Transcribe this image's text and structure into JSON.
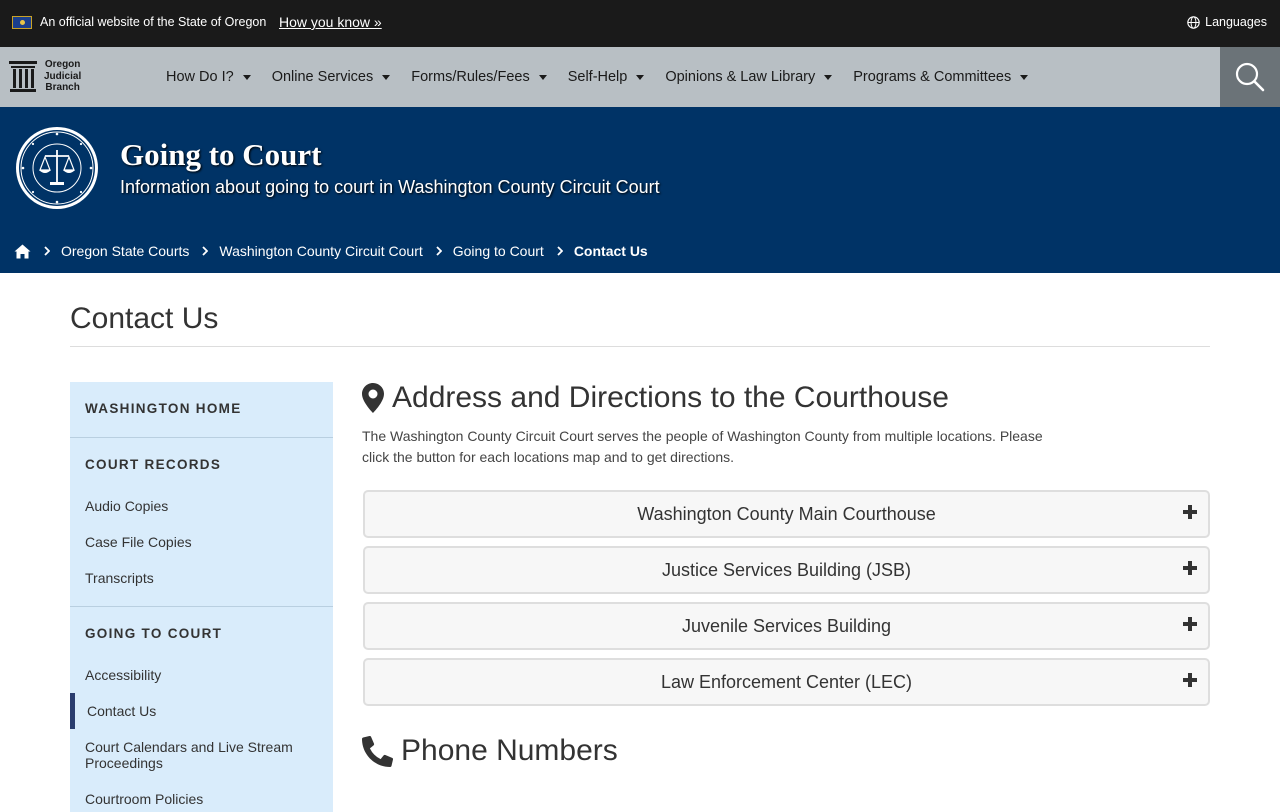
{
  "gov_banner": {
    "official_text": "An official website of the State of Oregon",
    "how_you_know": "How you know »",
    "languages": "Languages"
  },
  "logo": {
    "line1": "Oregon",
    "line2": "Judicial",
    "line3": "Branch"
  },
  "nav": {
    "items": [
      {
        "label": "How Do I?"
      },
      {
        "label": "Online Services"
      },
      {
        "label": "Forms/Rules/Fees"
      },
      {
        "label": "Self-Help"
      },
      {
        "label": "Opinions & Law Library"
      },
      {
        "label": "Programs & Committees"
      }
    ],
    "search_icon": "search-icon"
  },
  "hero": {
    "title": "Going to Court",
    "subtitle": "Information about going to court in Washington County Circuit Court",
    "seal_icon": "judicial-department-seal"
  },
  "breadcrumb": {
    "items": [
      "Oregon State Courts",
      "Washington County Circuit Court",
      "Going to Court"
    ],
    "current": "Contact Us"
  },
  "page": {
    "title": "Contact Us"
  },
  "sidebar": {
    "home": "WASHINGTON HOME",
    "court_records": {
      "heading": "COURT RECORDS",
      "links": [
        "Audio Copies",
        "Case File Copies",
        "Transcripts"
      ]
    },
    "going_to_court": {
      "heading": "GOING TO COURT",
      "links": [
        "Accessibility",
        "Contact Us",
        "Court Calendars and Live Stream Proceedings",
        "Courtroom Policies"
      ],
      "active": "Contact Us"
    }
  },
  "content": {
    "address_title": "Address and Directions to the Courthouse",
    "address_icon": "map-marker-icon",
    "intro": "The Washington County Circuit Court serves the people of Washington County from multiple locations. Please click the button for each locations map and to get directions.",
    "locations": [
      "Washington County Main Courthouse",
      "Justice Services Building (JSB)",
      "Juvenile Services Building",
      "Law Enforcement Center (LEC)"
    ],
    "phone_title": "Phone Numbers",
    "phone_icon": "phone-icon"
  },
  "colors": {
    "gov_banner_bg": "#1a1a1a",
    "nav_bg": "#b8bfc4",
    "hero_bg": "#003366",
    "sidebar_bg": "#d9ecfb",
    "active_bar": "#2a3d6e"
  }
}
